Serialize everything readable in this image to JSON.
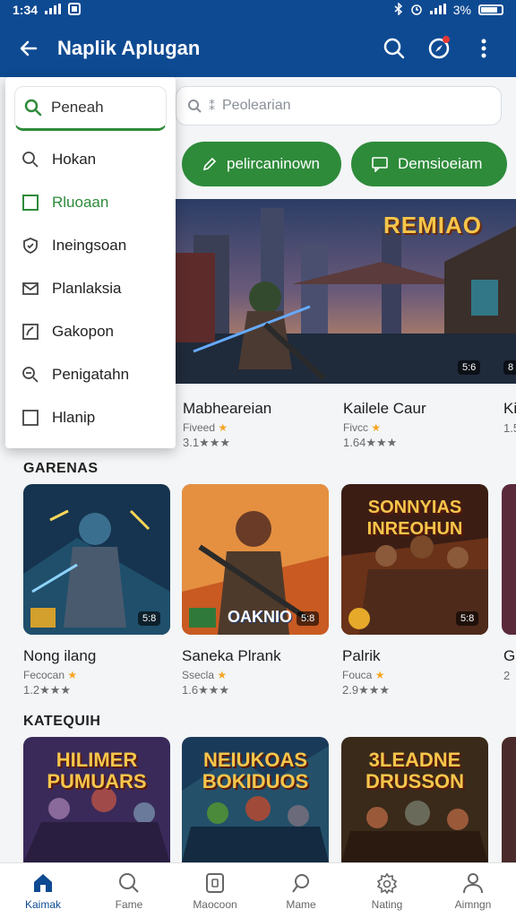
{
  "status_bar": {
    "time": "1:34",
    "battery": "3%"
  },
  "app_bar": {
    "title": "Naplik Aplugan"
  },
  "search": {
    "placeholder": "Peolearian"
  },
  "chips": [
    {
      "label": "pelircaninown",
      "icon": "pencil-icon"
    },
    {
      "label": "Demsioeiam",
      "icon": "chat-icon"
    }
  ],
  "banner": {
    "title": "REMIAO",
    "badge_left": "5:6",
    "badge_right": "8"
  },
  "featured_apps": [
    {
      "name": "Mabheareian",
      "sub": "Fiveed",
      "rating": "3.1"
    },
    {
      "name": "Kailele Caur",
      "sub": "Fivcc",
      "rating": "1.64"
    },
    {
      "name": "Ki",
      "sub": "",
      "rating": "1.5"
    }
  ],
  "sections": {
    "games": "GARENAS",
    "categories": "KATEQUIH"
  },
  "game_tiles": [
    {
      "name": "Nong ilang",
      "sub": "Fecocan",
      "rating": "1.2",
      "badge": "5:8"
    },
    {
      "name": "Saneka Plrank",
      "sub": "Ssecla",
      "rating": "1.6",
      "badge": "5:8",
      "overlay_text": "OAKNIO"
    },
    {
      "name": "Palrik",
      "sub": "Fouca",
      "rating": "2.9",
      "badge": "5:8",
      "overlay_text": "SONNYIAS INREOHUN"
    },
    {
      "name": "G",
      "sub": "",
      "rating": "2"
    }
  ],
  "category_tiles": [
    {
      "overlay_text": "HILIMER PUMUARS"
    },
    {
      "overlay_text": "NEIUKOAS BOKIDUOS"
    },
    {
      "overlay_text": "3LEADNE DRUSSON"
    }
  ],
  "dropdown": {
    "search_value": "Peneah",
    "items": [
      {
        "label": "Hokan",
        "icon": "search-icon"
      },
      {
        "label": "Rluoaan",
        "icon": "checkbox-icon"
      },
      {
        "label": "Ineingsoan",
        "icon": "shield-icon"
      },
      {
        "label": "Planlaksia",
        "icon": "mail-icon"
      },
      {
        "label": "Gakopon",
        "icon": "edit-box-icon"
      },
      {
        "label": "Penigatahn",
        "icon": "zoom-icon"
      },
      {
        "label": "Hlanip",
        "icon": "checkbox-icon"
      }
    ]
  },
  "bottom_nav": [
    {
      "label": "Kaimak",
      "icon": "home-icon"
    },
    {
      "label": "Fame",
      "icon": "search-icon"
    },
    {
      "label": "Maocoon",
      "icon": "square-icon"
    },
    {
      "label": "Mame",
      "icon": "location-icon"
    },
    {
      "label": "Nating",
      "icon": "gear-icon"
    },
    {
      "label": "Aimngn",
      "icon": "person-icon"
    }
  ],
  "colors": {
    "primary": "#0e4a92",
    "accent": "#2e8b3a",
    "star": "#f5a623"
  }
}
